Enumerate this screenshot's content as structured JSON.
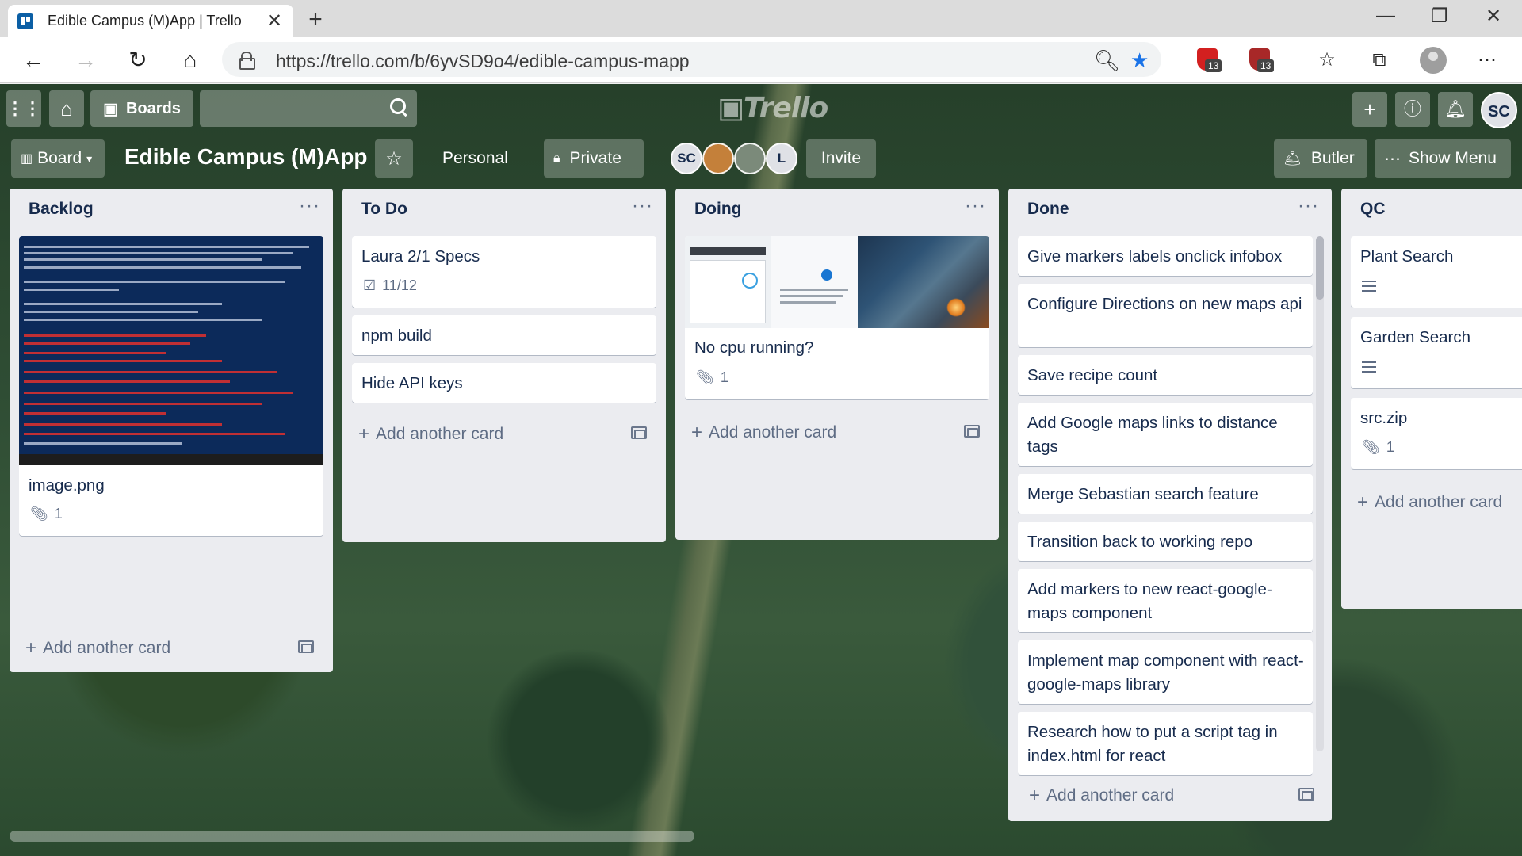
{
  "browser": {
    "tab_title": "Edible Campus (M)App | Trello",
    "url": "https://trello.com/b/6yvSD9o4/edible-campus-mapp",
    "ext_badge_1": "13",
    "ext_badge_2": "13"
  },
  "topbar": {
    "boards_label": "Boards",
    "logo_text": "Trello",
    "user_initials": "SC"
  },
  "boardbar": {
    "view_label": "Board",
    "title": "Edible Campus (M)App",
    "team_label": "Personal",
    "visibility_label": "Private",
    "members": [
      "SC",
      "",
      "",
      "L"
    ],
    "invite_label": "Invite",
    "butler_label": "Butler",
    "menu_label": "Show Menu"
  },
  "lists": [
    {
      "name": "Backlog",
      "cards": [
        {
          "title": "image.png",
          "attachments": "1"
        }
      ],
      "add_label": "Add another card"
    },
    {
      "name": "To Do",
      "cards": [
        {
          "title": "Laura 2/1 Specs",
          "checklist": "11/12"
        },
        {
          "title": "npm build"
        },
        {
          "title": "Hide API keys"
        }
      ],
      "add_label": "Add another card"
    },
    {
      "name": "Doing",
      "cards": [
        {
          "title": "No cpu running?",
          "attachments": "1"
        }
      ],
      "add_label": "Add another card"
    },
    {
      "name": "Done",
      "cards": [
        {
          "title": "Give markers labels onclick infobox"
        },
        {
          "title": "Configure Directions on new maps api"
        },
        {
          "title": "Save recipe count"
        },
        {
          "title": "Add Google maps links to distance tags"
        },
        {
          "title": "Merge Sebastian search feature"
        },
        {
          "title": "Transition back to working repo"
        },
        {
          "title": "Add markers to new react-google-maps component"
        },
        {
          "title": "Implement map component with react-google-maps library"
        },
        {
          "title": "Research how to put a script tag in index.html for react"
        }
      ],
      "add_label": "Add another card"
    },
    {
      "name": "QC",
      "cards": [
        {
          "title": "Plant Search"
        },
        {
          "title": "Garden Search"
        },
        {
          "title": "src.zip",
          "attachments": "1"
        }
      ],
      "add_label": "Add another card"
    }
  ],
  "icons": {
    "apps": "apps-grid-icon",
    "home": "home-icon",
    "boards": "boards-icon",
    "search": "search-icon",
    "add": "plus-icon",
    "info": "info-icon",
    "notifications": "bell-icon"
  },
  "colors": {
    "list_bg": "#ebecf0",
    "card_text": "#172b4d",
    "muted": "#5e6c84",
    "ext_red": "#d32020"
  }
}
